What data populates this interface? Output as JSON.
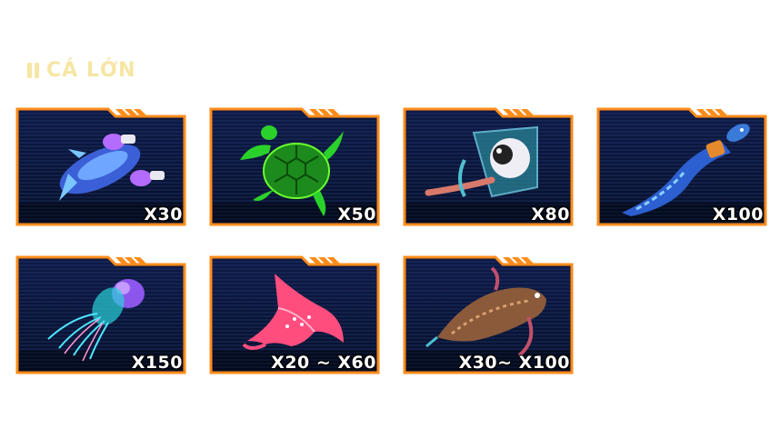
{
  "section": {
    "title": "CÁ LỚN"
  },
  "cards": [
    {
      "icon": "blue-alien-ship-fish-icon",
      "multiplier": "X30"
    },
    {
      "icon": "green-turtle-icon",
      "multiplier": "X50"
    },
    {
      "icon": "eyeball-squid-icon",
      "multiplier": "X80"
    },
    {
      "icon": "blue-eel-icon",
      "multiplier": "X100"
    },
    {
      "icon": "jellyfish-icon",
      "multiplier": "X150"
    },
    {
      "icon": "pink-manta-ray-icon",
      "multiplier": "X20 ~ X60"
    },
    {
      "icon": "spiny-flatfish-icon",
      "multiplier": "X30~ X100"
    }
  ],
  "colors": {
    "frame_orange": "#ff8c1a",
    "card_bg": "#0b1433",
    "title": "#f5e6a3"
  }
}
